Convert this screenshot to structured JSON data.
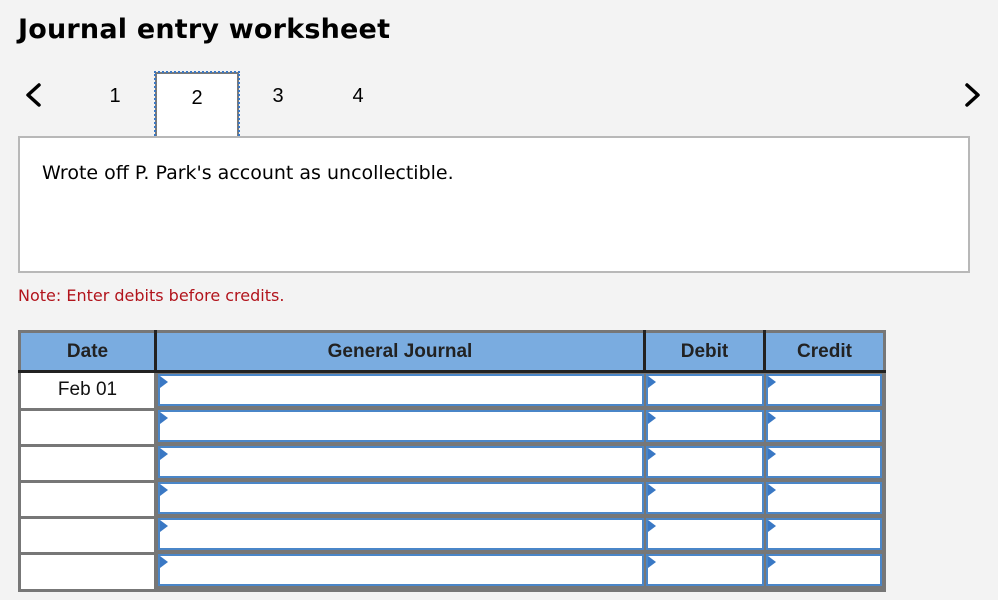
{
  "header": {
    "title": "Journal entry worksheet"
  },
  "navigation": {
    "prev_icon": "chevron-left-icon",
    "next_icon": "chevron-right-icon",
    "tabs": [
      {
        "label": "1",
        "active": false
      },
      {
        "label": "2",
        "active": true
      },
      {
        "label": "3",
        "active": false
      },
      {
        "label": "4",
        "active": false
      }
    ]
  },
  "transaction": {
    "description": "Wrote off P. Park's account as uncollectible."
  },
  "note": "Note: Enter debits before credits.",
  "journal": {
    "columns": [
      "Date",
      "General Journal",
      "Debit",
      "Credit"
    ],
    "rows": [
      {
        "date": "Feb 01",
        "account": "",
        "debit": "",
        "credit": ""
      },
      {
        "date": "",
        "account": "",
        "debit": "",
        "credit": ""
      },
      {
        "date": "",
        "account": "",
        "debit": "",
        "credit": ""
      },
      {
        "date": "",
        "account": "",
        "debit": "",
        "credit": ""
      },
      {
        "date": "",
        "account": "",
        "debit": "",
        "credit": ""
      },
      {
        "date": "",
        "account": "",
        "debit": "",
        "credit": ""
      }
    ]
  },
  "colors": {
    "header_blue": "#7aace0",
    "input_border": "#4a86c8",
    "note_red": "#b2141c",
    "active_tab_outline": "#3a78c4"
  }
}
